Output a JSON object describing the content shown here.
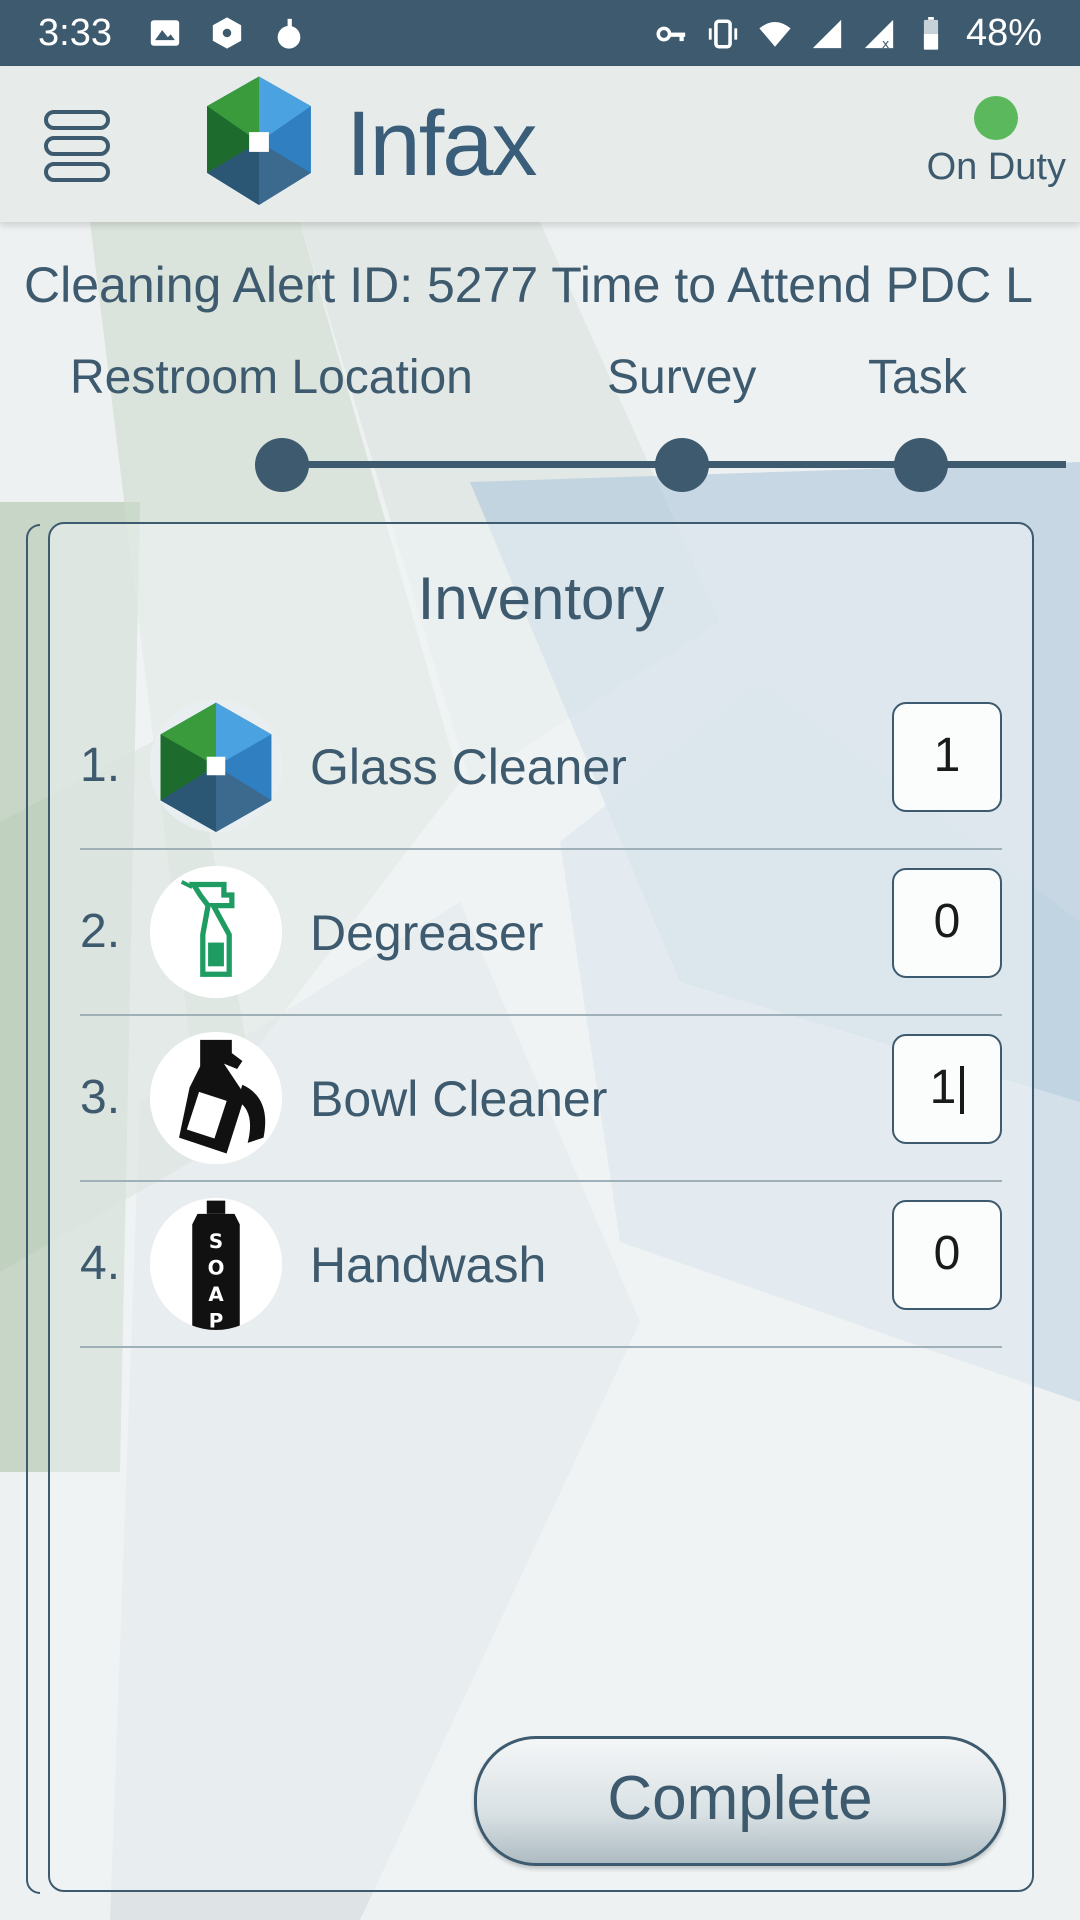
{
  "status_bar": {
    "time": "3:33",
    "battery": "48%",
    "icons_left": [
      "image-icon",
      "settings-hex-icon",
      "bomb-icon"
    ],
    "icons_right": [
      "key-icon",
      "vibrate-icon",
      "wifi-icon",
      "signal-icon",
      "signal-x-icon",
      "battery-icon"
    ]
  },
  "app_bar": {
    "brand": "Infax",
    "duty_status": "On Duty",
    "duty_color": "#5cb85c"
  },
  "alert": {
    "title": "Cleaning Alert ID: 5277 Time to Attend PDC L"
  },
  "steps": [
    {
      "label": "Restroom Location"
    },
    {
      "label": "Survey"
    },
    {
      "label": "Task"
    }
  ],
  "inventory": {
    "title": "Inventory",
    "items": [
      {
        "number": "1.",
        "name": "Glass Cleaner",
        "quantity": "1",
        "icon": "infax-logo-icon"
      },
      {
        "number": "2.",
        "name": "Degreaser",
        "quantity": "0",
        "icon": "spray-bottle-icon"
      },
      {
        "number": "3.",
        "name": "Bowl Cleaner",
        "quantity": "1",
        "icon": "cleaner-bottle-icon"
      },
      {
        "number": "4.",
        "name": "Handwash",
        "quantity": "0",
        "icon": "soap-bottle-icon"
      }
    ]
  },
  "actions": {
    "complete_label": "Complete"
  },
  "colors": {
    "primary": "#3d5a6e",
    "status_bar": "#3d5a6e"
  }
}
